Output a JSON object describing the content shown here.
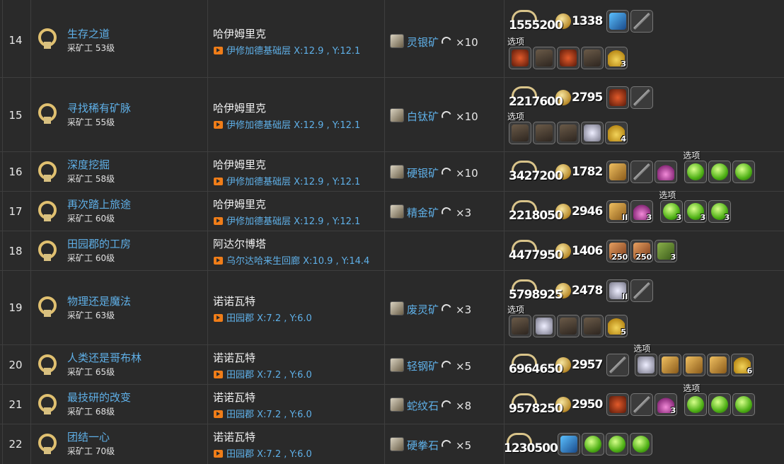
{
  "rows": [
    {
      "num": "14",
      "name": "生存之道",
      "level": "采矿工 53级",
      "npc": "哈伊姆里克",
      "loc": "伊修加德基础层 X:12.9 , Y:12.1",
      "item": "灵银矿",
      "qty": "×10",
      "exp": "1555200",
      "gil": "1338",
      "opt": "选项",
      "q1": "3"
    },
    {
      "num": "15",
      "name": "寻找稀有矿脉",
      "level": "采矿工 55级",
      "npc": "哈伊姆里克",
      "loc": "伊修加德基础层 X:12.9 , Y:12.1",
      "item": "白钛矿",
      "qty": "×10",
      "exp": "2217600",
      "gil": "2795",
      "opt": "选项",
      "q1": "4"
    },
    {
      "num": "16",
      "name": "深度挖掘",
      "level": "采矿工 58级",
      "npc": "哈伊姆里克",
      "loc": "伊修加德基础层 X:12.9 , Y:12.1",
      "item": "硬银矿",
      "qty": "×10",
      "exp": "3427200",
      "gil": "1782",
      "opt": "选项"
    },
    {
      "num": "17",
      "name": "再次踏上旅途",
      "level": "采矿工 60级",
      "npc": "哈伊姆里克",
      "loc": "伊修加德基础层 X:12.9 , Y:12.1",
      "item": "精金矿",
      "qty": "×3",
      "exp": "2218050",
      "gil": "2946",
      "opt": "选项",
      "q1": "II",
      "q2": "3",
      "q3": "3",
      "q4": "3",
      "q5": "3"
    },
    {
      "num": "18",
      "name": "田园郡的工房",
      "level": "采矿工 60级",
      "npc": "阿达尔博塔",
      "loc": "乌尔达哈来生回廊 X:10.9 , Y:14.4",
      "exp": "4477950",
      "gil": "1406",
      "q1": "250",
      "q2": "250",
      "q3": "3"
    },
    {
      "num": "19",
      "name": "物理还是魔法",
      "level": "采矿工 63级",
      "npc": "诺诺瓦特",
      "loc": "田园郡 X:7.2 , Y:6.0",
      "item": "废灵矿",
      "qty": "×3",
      "exp": "5798925",
      "gil": "2478",
      "opt": "选项",
      "q1": "II",
      "q2": "5"
    },
    {
      "num": "20",
      "name": "人类还是哥布林",
      "level": "采矿工 65级",
      "npc": "诺诺瓦特",
      "loc": "田园郡 X:7.2 , Y:6.0",
      "item": "轻钢矿",
      "qty": "×5",
      "exp": "6964650",
      "gil": "2957",
      "opt": "选项",
      "q1": "6"
    },
    {
      "num": "21",
      "name": "最技研的改变",
      "level": "采矿工 68级",
      "npc": "诺诺瓦特",
      "loc": "田园郡 X:7.2 , Y:6.0",
      "item": "蛇纹石",
      "qty": "×8",
      "exp": "9578250",
      "gil": "2950",
      "opt": "选项",
      "q1": "3"
    },
    {
      "num": "22",
      "name": "团结一心",
      "level": "采矿工 70级",
      "npc": "诺诺瓦特",
      "loc": "田园郡 X:7.2 , Y:6.0",
      "item": "硬拳石",
      "qty": "×5",
      "exp": "12305000"
    }
  ]
}
